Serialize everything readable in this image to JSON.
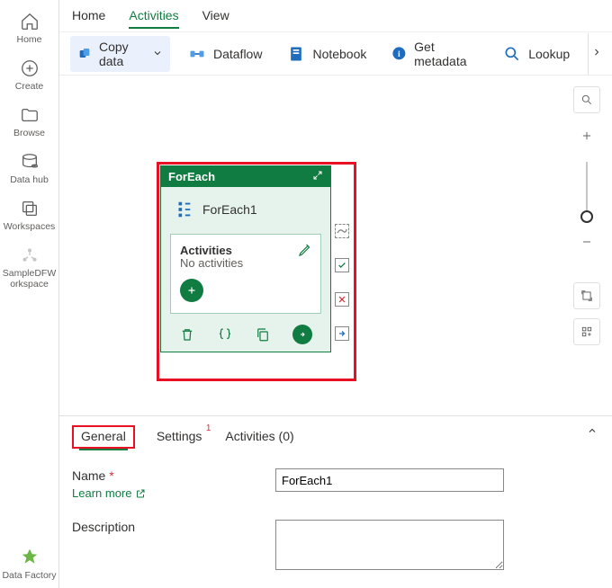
{
  "rail": {
    "items": [
      {
        "label": "Home",
        "icon": "home"
      },
      {
        "label": "Create",
        "icon": "plus-circle"
      },
      {
        "label": "Browse",
        "icon": "folder"
      },
      {
        "label": "Data hub",
        "icon": "database"
      },
      {
        "label": "Workspaces",
        "icon": "workspaces"
      },
      {
        "label": "SampleDFW\norkspace",
        "icon": "workspace-node"
      }
    ],
    "bottom": {
      "label": "Data Factory",
      "icon": "data-factory"
    }
  },
  "tabs": {
    "home": "Home",
    "activities": "Activities",
    "view": "View",
    "active": "activities"
  },
  "toolbar": {
    "copydata": "Copy data",
    "dataflow": "Dataflow",
    "notebook": "Notebook",
    "getmeta": "Get metadata",
    "lookup": "Lookup"
  },
  "activity": {
    "type": "ForEach",
    "name": "ForEach1",
    "inner_title": "Activities",
    "inner_sub": "No activities"
  },
  "props": {
    "tabs": {
      "general": "General",
      "settings": "Settings",
      "activities": "Activities (0)",
      "settings_badge": "1"
    },
    "name_label": "Name",
    "learn_more": "Learn more",
    "desc_label": "Description",
    "name_value": "ForEach1",
    "desc_value": ""
  },
  "colors": {
    "accent": "#107c41",
    "danger": "#e81123"
  }
}
